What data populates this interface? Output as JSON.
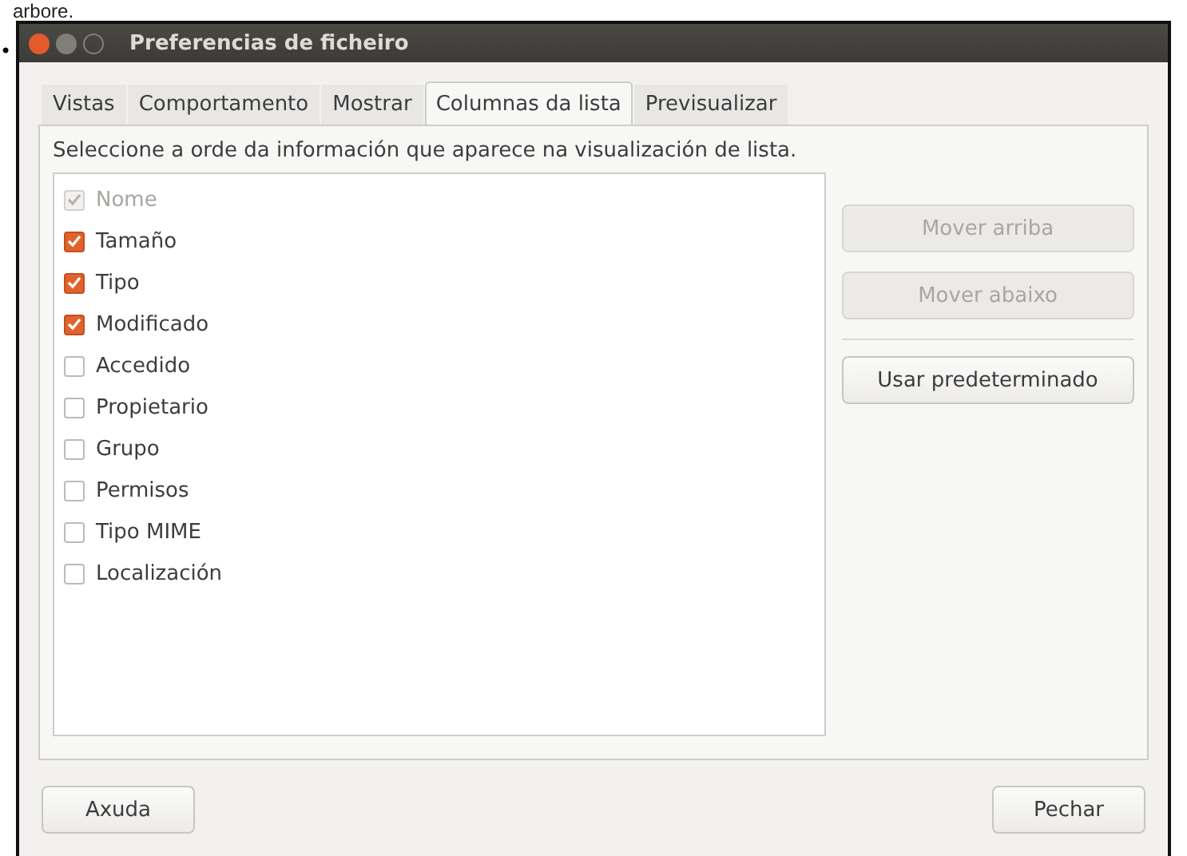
{
  "page_text": "arbore.",
  "bullet": "•",
  "window": {
    "title": "Preferencias de ficheiro"
  },
  "tabs": [
    {
      "label": "Vistas",
      "selected": false
    },
    {
      "label": "Comportamento",
      "selected": false
    },
    {
      "label": "Mostrar",
      "selected": false
    },
    {
      "label": "Columnas da lista",
      "selected": true
    },
    {
      "label": "Previsualizar",
      "selected": false
    }
  ],
  "description": "Seleccione a orde da información que aparece na visualización de lista.",
  "columns": [
    {
      "label": "Nome",
      "checked": true,
      "disabled": true
    },
    {
      "label": "Tamaño",
      "checked": true,
      "disabled": false
    },
    {
      "label": "Tipo",
      "checked": true,
      "disabled": false
    },
    {
      "label": "Modificado",
      "checked": true,
      "disabled": false
    },
    {
      "label": "Accedido",
      "checked": false,
      "disabled": false
    },
    {
      "label": "Propietario",
      "checked": false,
      "disabled": false
    },
    {
      "label": "Grupo",
      "checked": false,
      "disabled": false
    },
    {
      "label": "Permisos",
      "checked": false,
      "disabled": false
    },
    {
      "label": "Tipo MIME",
      "checked": false,
      "disabled": false
    },
    {
      "label": "Localización",
      "checked": false,
      "disabled": false
    }
  ],
  "side_buttons": [
    {
      "label": "Mover arriba",
      "disabled": true
    },
    {
      "label": "Mover abaixo",
      "disabled": true
    },
    {
      "label": "Usar predeterminado",
      "disabled": false
    }
  ],
  "footer": {
    "help": "Axuda",
    "close": "Pechar"
  }
}
